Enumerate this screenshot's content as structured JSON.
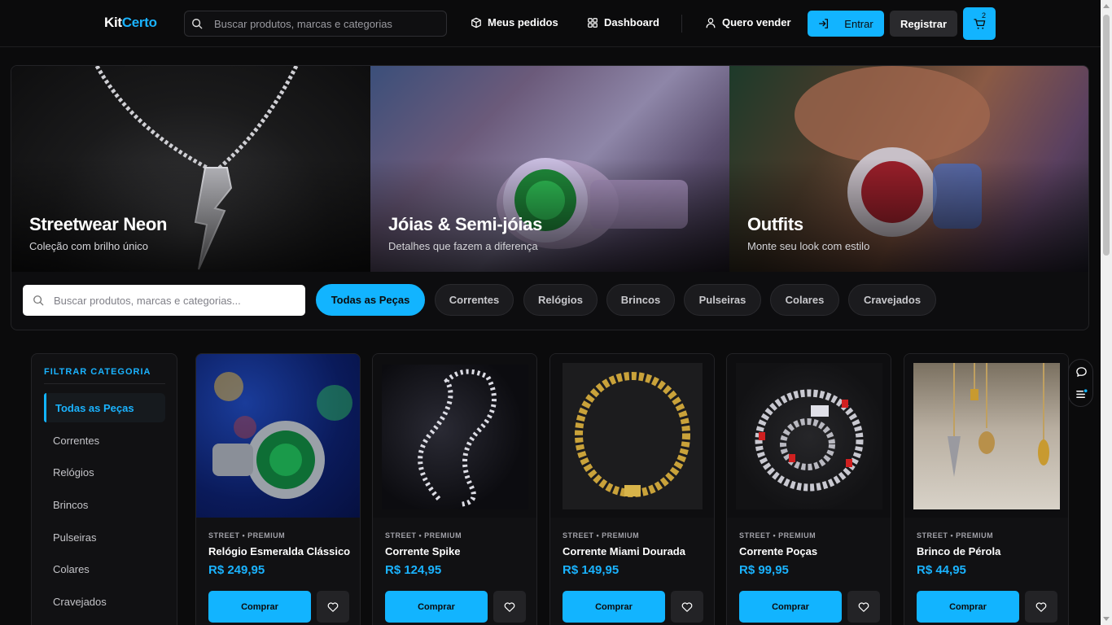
{
  "header": {
    "logo_part1": "Kit",
    "logo_part2": "Certo",
    "search_placeholder": "Buscar produtos, marcas e categorias",
    "orders_label": "Meus pedidos",
    "dashboard_label": "Dashboard",
    "sell_label": "Quero vender",
    "login_label": "Entrar",
    "register_label": "Registrar",
    "cart_count": "2"
  },
  "banners": [
    {
      "title": "Streetwear Neon",
      "subtitle": "Coleção com brilho único"
    },
    {
      "title": "Jóias & Semi-jóias",
      "subtitle": "Detalhes que fazem a diferença"
    },
    {
      "title": "Outfits",
      "subtitle": "Monte seu look com estilo"
    }
  ],
  "filters": {
    "search_placeholder": "Buscar produtos, marcas e categorias...",
    "chips": [
      "Todas as Peças",
      "Correntes",
      "Relógios",
      "Brincos",
      "Pulseiras",
      "Colares",
      "Cravejados"
    ],
    "active": "Todas as Peças"
  },
  "sidebar": {
    "title": "FILTRAR CATEGORIA",
    "items": [
      "Todas as Peças",
      "Correntes",
      "Relógios",
      "Brincos",
      "Pulseiras",
      "Colares",
      "Cravejados"
    ]
  },
  "products": [
    {
      "tag": "STREET • PREMIUM",
      "name": "Relógio Esmeralda Clássico",
      "price": "R$ 249,95",
      "buy": "Comprar"
    },
    {
      "tag": "STREET • PREMIUM",
      "name": "Corrente Spike",
      "price": "R$ 124,95",
      "buy": "Comprar"
    },
    {
      "tag": "STREET • PREMIUM",
      "name": "Corrente Miami Dourada",
      "price": "R$ 149,95",
      "buy": "Comprar"
    },
    {
      "tag": "STREET • PREMIUM",
      "name": "Corrente Poças",
      "price": "R$ 99,95",
      "buy": "Comprar"
    },
    {
      "tag": "STREET • PREMIUM",
      "name": "Brinco de Pérola",
      "price": "R$ 44,95",
      "buy": "Comprar"
    }
  ],
  "colors": {
    "accent": "#12b4ff",
    "background": "#0b0b0c",
    "card": "#111113"
  }
}
